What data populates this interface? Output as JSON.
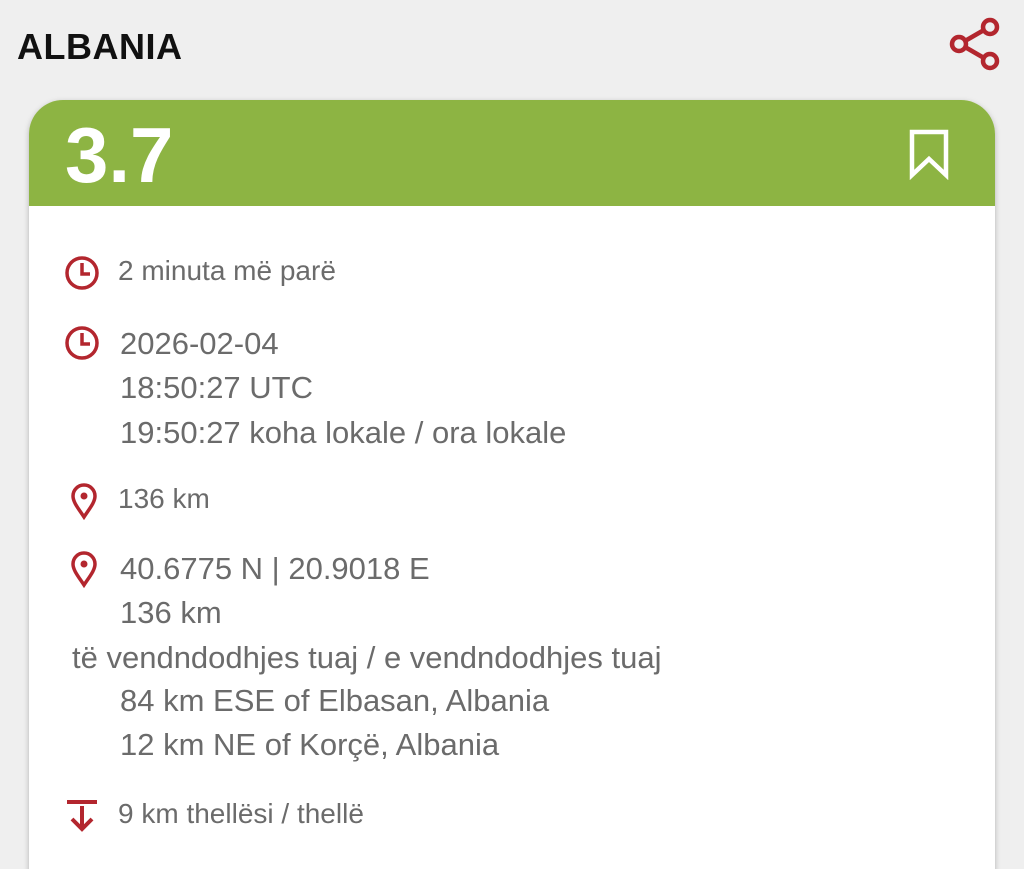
{
  "header": {
    "country": "ALBANIA",
    "share_icon": "share-icon"
  },
  "event": {
    "magnitude": "3.7",
    "bookmark_icon": "bookmark-icon",
    "color": "#8db443",
    "relative_time": "2 minuta më parë",
    "date": "2026-02-04",
    "utc_time": "18:50:27 UTC",
    "local_time": "19:50:27 koha lokale / ora lokale",
    "distance_short": "136 km",
    "coordinates": "40.6775 N | 20.9018 E",
    "distance": "136 km",
    "distance_label": "të vendndodhjes tuaj / e vendndodhjes tuaj",
    "region_1": "84 km ESE of Elbasan, Albania",
    "region_2": "12 km NE of Korçë, Albania",
    "depth": "9 km thellësi / thellë"
  },
  "icons": {
    "clock": "clock-icon",
    "pin": "location-pin-icon",
    "depth": "depth-icon",
    "accent": "#b3262e"
  }
}
